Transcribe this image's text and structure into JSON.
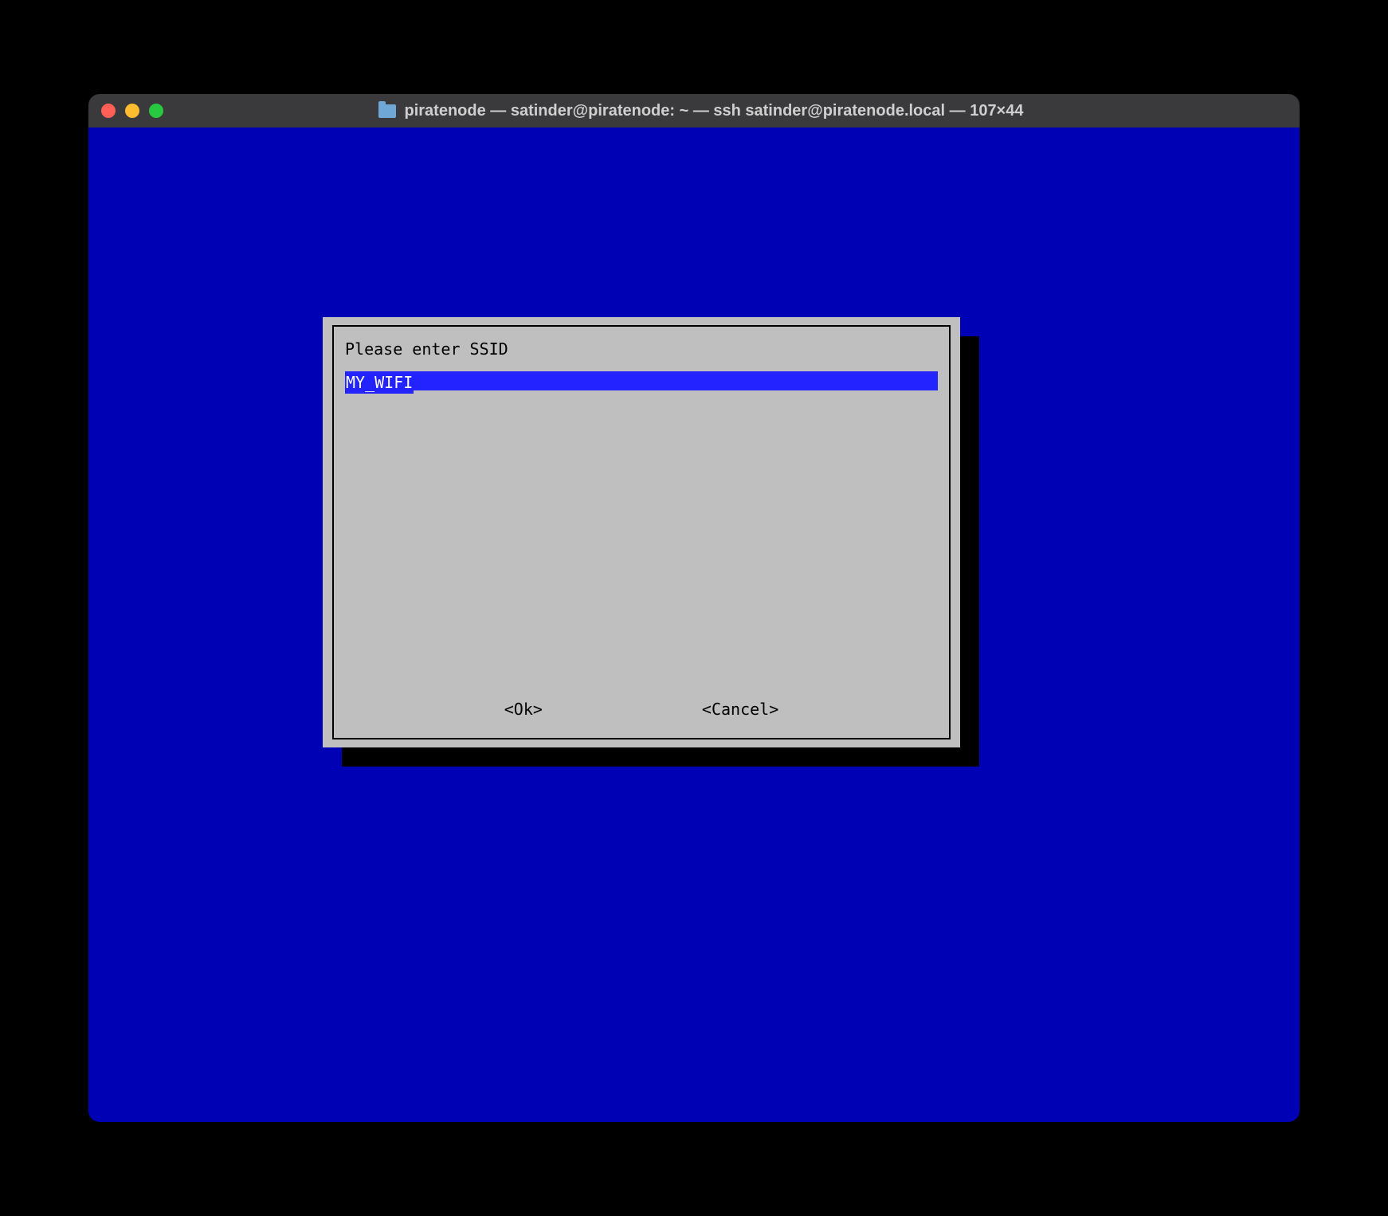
{
  "window": {
    "title": "piratenode — satinder@piratenode: ~ — ssh satinder@piratenode.local — 107×44"
  },
  "dialog": {
    "prompt": "Please enter SSID",
    "input_value": "MY_WIFI",
    "input_fill": "____________________________________________________",
    "buttons": {
      "ok": "<Ok>",
      "cancel": "<Cancel>"
    }
  }
}
